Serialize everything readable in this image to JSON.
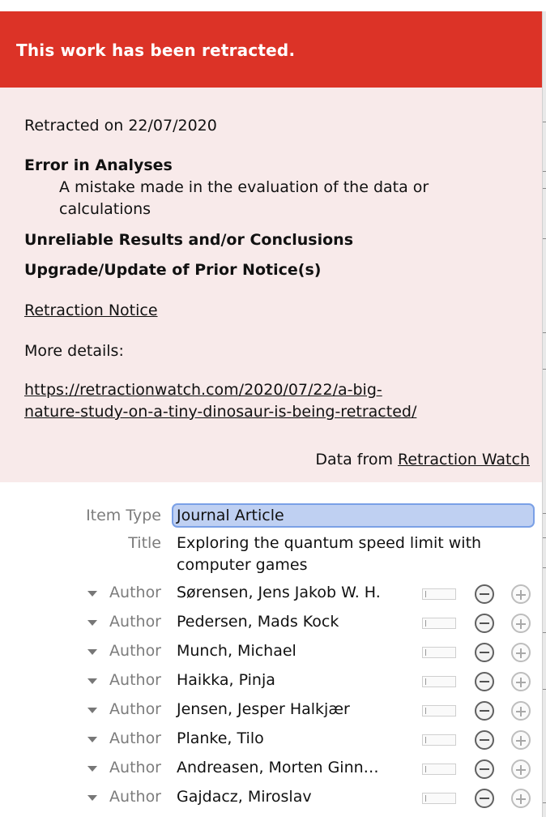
{
  "retraction": {
    "banner": "This work has been retracted.",
    "date_line": "Retracted on 22/07/2020",
    "reasons": [
      {
        "title": "Error in Analyses",
        "desc_line1": "A mistake made in the evaluation of the data or",
        "desc_line2": "calculations"
      },
      {
        "title": "Unreliable Results and/or Conclusions"
      },
      {
        "title": "Upgrade/Update of Prior Notice(s)"
      }
    ],
    "notice_link": "Retraction Notice",
    "more_details_label": "More details:",
    "details_url_line1": "https://retractionwatch.com/2020/07/22/a-big-",
    "details_url_line2": "nature-study-on-a-tiny-dinosaur-is-being-retracted/",
    "data_from_label": "Data from",
    "data_from_link": "Retraction Watch"
  },
  "item": {
    "item_type_label": "Item Type",
    "item_type_value": "Journal Article",
    "title_label": "Title",
    "title_line1": "Exploring the quantum speed limit with",
    "title_line2": "computer games",
    "author_label": "Author",
    "authors": [
      "Sørensen, Jens Jakob W. H.",
      "Pedersen, Mads Kock",
      "Munch, Michael",
      "Haikka, Pinja",
      "Jensen, Jesper Halkjær",
      "Planke, Tilo",
      "Andreasen, Morten Ginn…",
      "Gajdacz, Miroslav"
    ]
  },
  "colors": {
    "banner_bg": "#dc3327",
    "notice_bg": "#f8eaea",
    "selection_bg": "#bfd0f2"
  }
}
